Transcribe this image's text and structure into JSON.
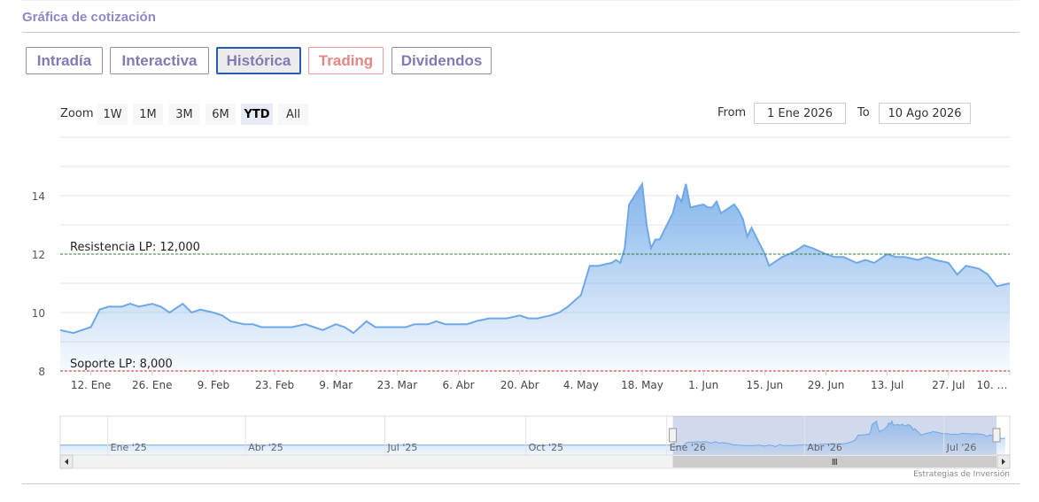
{
  "header": {
    "title": "Gráfica de cotización"
  },
  "tabs": [
    {
      "label": "Intradía",
      "active": false
    },
    {
      "label": "Interactiva",
      "active": false
    },
    {
      "label": "Histórica",
      "active": true
    },
    {
      "label": "Trading",
      "active": false
    },
    {
      "label": "Dividendos",
      "active": false
    }
  ],
  "zoom": {
    "label": "Zoom",
    "buttons": [
      "1W",
      "1M",
      "3M",
      "6M",
      "YTD",
      "All"
    ],
    "selected": "YTD"
  },
  "range": {
    "from_label": "From",
    "from_value": "1 Ene 2026",
    "to_label": "To",
    "to_value": "10 Ago 2026"
  },
  "credit": "Estrategias de Inversión",
  "colors": {
    "accent": "#7f7bb5",
    "line": "#6fa8e8",
    "resistance": "#2e7d32",
    "support": "#c62828",
    "trading": "#e68585"
  },
  "chart_data": {
    "type": "area",
    "y_ticks": [
      "8",
      "10",
      "12",
      "14"
    ],
    "ylim": [
      8,
      16
    ],
    "x_ticks": [
      "12. Ene",
      "26. Ene",
      "9. Feb",
      "23. Feb",
      "9. Mar",
      "23. Mar",
      "6. Abr",
      "20. Abr",
      "4. May",
      "18. May",
      "1. Jun",
      "15. Jun",
      "29. Jun",
      "13. Jul",
      "27. Jul",
      "10. …"
    ],
    "x": [
      "2026-01-05",
      "2026-01-08",
      "2026-01-12",
      "2026-01-14",
      "2026-01-16",
      "2026-01-19",
      "2026-01-21",
      "2026-01-23",
      "2026-01-26",
      "2026-01-28",
      "2026-01-30",
      "2026-02-02",
      "2026-02-04",
      "2026-02-06",
      "2026-02-09",
      "2026-02-11",
      "2026-02-13",
      "2026-02-16",
      "2026-02-18",
      "2026-02-20",
      "2026-02-23",
      "2026-02-25",
      "2026-02-27",
      "2026-03-02",
      "2026-03-04",
      "2026-03-06",
      "2026-03-09",
      "2026-03-11",
      "2026-03-13",
      "2026-03-16",
      "2026-03-18",
      "2026-03-20",
      "2026-03-23",
      "2026-03-25",
      "2026-03-27",
      "2026-03-30",
      "2026-04-01",
      "2026-04-03",
      "2026-04-06",
      "2026-04-08",
      "2026-04-10",
      "2026-04-13",
      "2026-04-15",
      "2026-04-17",
      "2026-04-20",
      "2026-04-22",
      "2026-04-24",
      "2026-04-27",
      "2026-04-29",
      "2026-05-01",
      "2026-05-04",
      "2026-05-06",
      "2026-05-08",
      "2026-05-11",
      "2026-05-12",
      "2026-05-13",
      "2026-05-14",
      "2026-05-15",
      "2026-05-18",
      "2026-05-19",
      "2026-05-20",
      "2026-05-21",
      "2026-05-22",
      "2026-05-25",
      "2026-05-26",
      "2026-05-27",
      "2026-05-28",
      "2026-05-29",
      "2026-06-01",
      "2026-06-02",
      "2026-06-03",
      "2026-06-04",
      "2026-06-05",
      "2026-06-08",
      "2026-06-09",
      "2026-06-10",
      "2026-06-11",
      "2026-06-12",
      "2026-06-15",
      "2026-06-16",
      "2026-06-17",
      "2026-06-18",
      "2026-06-19",
      "2026-06-22",
      "2026-06-24",
      "2026-06-26",
      "2026-06-29",
      "2026-07-01",
      "2026-07-03",
      "2026-07-06",
      "2026-07-08",
      "2026-07-10",
      "2026-07-13",
      "2026-07-15",
      "2026-07-17",
      "2026-07-20",
      "2026-07-22",
      "2026-07-24",
      "2026-07-27",
      "2026-07-29",
      "2026-07-31",
      "2026-08-03",
      "2026-08-05",
      "2026-08-07",
      "2026-08-10"
    ],
    "y": [
      9.4,
      9.3,
      9.5,
      10.1,
      10.2,
      10.2,
      10.3,
      10.2,
      10.3,
      10.2,
      10.0,
      10.3,
      10.0,
      10.1,
      10.0,
      9.9,
      9.7,
      9.6,
      9.6,
      9.5,
      9.5,
      9.5,
      9.5,
      9.6,
      9.5,
      9.4,
      9.6,
      9.5,
      9.3,
      9.7,
      9.5,
      9.5,
      9.5,
      9.5,
      9.6,
      9.6,
      9.7,
      9.6,
      9.6,
      9.6,
      9.7,
      9.8,
      9.8,
      9.8,
      9.9,
      9.8,
      9.8,
      9.9,
      10.0,
      10.2,
      10.6,
      11.6,
      11.6,
      11.7,
      11.8,
      11.7,
      12.2,
      13.7,
      14.4,
      13.0,
      12.2,
      12.5,
      12.5,
      13.4,
      14.0,
      13.8,
      14.4,
      13.6,
      13.7,
      13.6,
      13.6,
      13.8,
      13.4,
      13.7,
      13.5,
      13.2,
      12.6,
      12.9,
      12.0,
      11.6,
      11.7,
      11.8,
      11.9,
      12.1,
      12.3,
      12.2,
      12.0,
      11.9,
      11.9,
      11.7,
      11.8,
      11.7,
      12.0,
      11.9,
      11.9,
      11.8,
      11.9,
      11.8,
      11.7,
      11.3,
      11.6,
      11.5,
      11.3,
      10.9,
      11.0
    ],
    "resistance": {
      "label": "Resistencia LP: 12,000",
      "value": 12
    },
    "support": {
      "label": "Soporte LP: 8,000",
      "value": 8
    },
    "navigator": {
      "x_ticks": [
        "Ene '25",
        "Abr '25",
        "Jul '25",
        "Oct '25",
        "Ene '26",
        "Abr '26",
        "Jul '26"
      ],
      "selection": [
        "1 Ene 2026",
        "10 Ago 2026"
      ]
    }
  }
}
